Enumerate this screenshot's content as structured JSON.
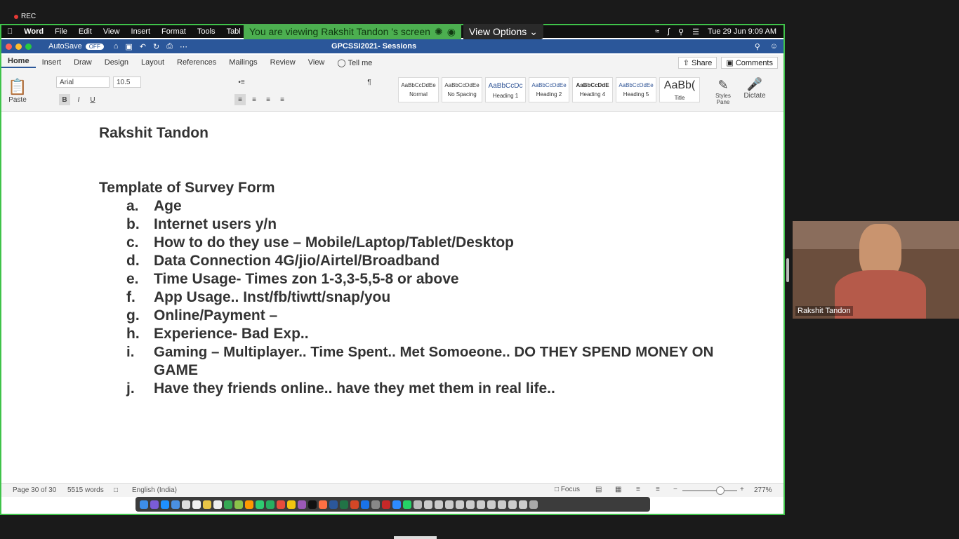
{
  "zoom": {
    "rec_label": "REC",
    "banner": "You are viewing Rakshit Tandon 's screen",
    "view_options": "View Options",
    "participant_name": "Rakshit Tandon"
  },
  "menubar": {
    "items": [
      "Word",
      "File",
      "Edit",
      "View",
      "Insert",
      "Format",
      "Tools",
      "Tabl"
    ],
    "clock": "Tue 29 Jun  9:09 AM"
  },
  "titlebar": {
    "autosave": "AutoSave",
    "autosave_state": "OFF",
    "doc_title": "GPCSSI2021- Sessions"
  },
  "tabs": [
    "Home",
    "Insert",
    "Draw",
    "Design",
    "Layout",
    "References",
    "Mailings",
    "Review",
    "View",
    "Tell me"
  ],
  "share": "Share",
  "comments": "Comments",
  "ribbon": {
    "paste": "Paste",
    "font": "Arial",
    "size": "10.5",
    "styles": [
      {
        "sample": "AaBbCcDdEe",
        "name": "Normal"
      },
      {
        "sample": "AaBbCcDdEe",
        "name": "No Spacing"
      },
      {
        "sample": "AaBbCcDc",
        "name": "Heading 1"
      },
      {
        "sample": "AaBbCcDdEe",
        "name": "Heading 2"
      },
      {
        "sample": "AaBbCcDdE",
        "name": "Heading 4"
      },
      {
        "sample": "AaBbCcDdEe",
        "name": "Heading 5"
      },
      {
        "sample": "AaBb(",
        "name": "Title"
      }
    ],
    "styles_pane": "Styles Pane",
    "dictate": "Dictate"
  },
  "document": {
    "name": "Rakshit Tandon",
    "title": "Template of Survey Form",
    "items": [
      {
        "marker": "a.",
        "text": "Age"
      },
      {
        "marker": "b.",
        "text": "Internet users y/n"
      },
      {
        "marker": "c.",
        "text": "How to do they use – Mobile/Laptop/Tablet/Desktop"
      },
      {
        "marker": "d.",
        "text": "Data Connection 4G/jio/Airtel/Broadband"
      },
      {
        "marker": "e.",
        "text": "Time Usage- Times zon 1-3,3-5,5-8 or above"
      },
      {
        "marker": "f.",
        "text": "App Usage.. Inst/fb/tiwtt/snap/you"
      },
      {
        "marker": "g.",
        "text": "Online/Payment –"
      },
      {
        "marker": "h.",
        "text": "Experience- Bad Exp.."
      },
      {
        "marker": "i.",
        "text": "Gaming – Multiplayer.. Time Spent.. Met Somoeone.. DO THEY SPEND MONEY ON"
      },
      {
        "marker": "",
        "text": "GAME"
      },
      {
        "marker": "j.",
        "text": "Have they friends online.. have they met them in real life.."
      }
    ]
  },
  "status": {
    "page": "Page 30 of 30",
    "words": "5515 words",
    "language": "English (India)",
    "focus": "Focus",
    "zoom": "277%"
  }
}
